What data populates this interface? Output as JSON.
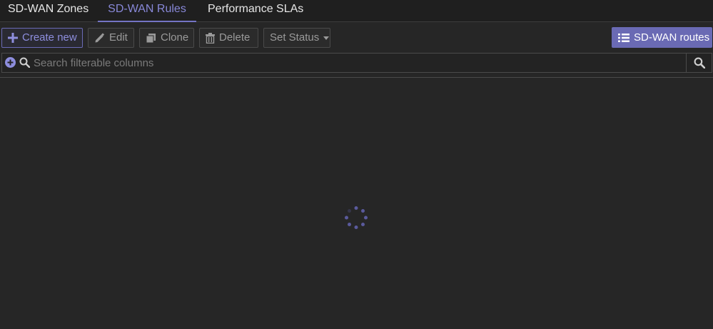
{
  "tabs": [
    {
      "label": "SD-WAN Zones",
      "active": false
    },
    {
      "label": "SD-WAN Rules",
      "active": true
    },
    {
      "label": "Performance SLAs",
      "active": false
    }
  ],
  "toolbar": {
    "create_label": "Create new",
    "edit_label": "Edit",
    "clone_label": "Clone",
    "delete_label": "Delete",
    "set_status_label": "Set Status",
    "routes_label": "SD-WAN routes"
  },
  "search": {
    "placeholder": "Search filterable columns",
    "value": ""
  },
  "icons": {
    "create": "plus-icon",
    "edit": "pencil-icon",
    "clone": "clone-icon",
    "delete": "trash-icon",
    "set_status": "caret-down-icon",
    "routes": "list-icon",
    "add_filter": "add-circle-icon",
    "search": "search-icon",
    "loading": "spinner-icon"
  },
  "colors": {
    "accent": "#6a6ab4",
    "active_tab_text": "#8888d8",
    "background": "#262626",
    "spinner": "#5a5a9c"
  }
}
